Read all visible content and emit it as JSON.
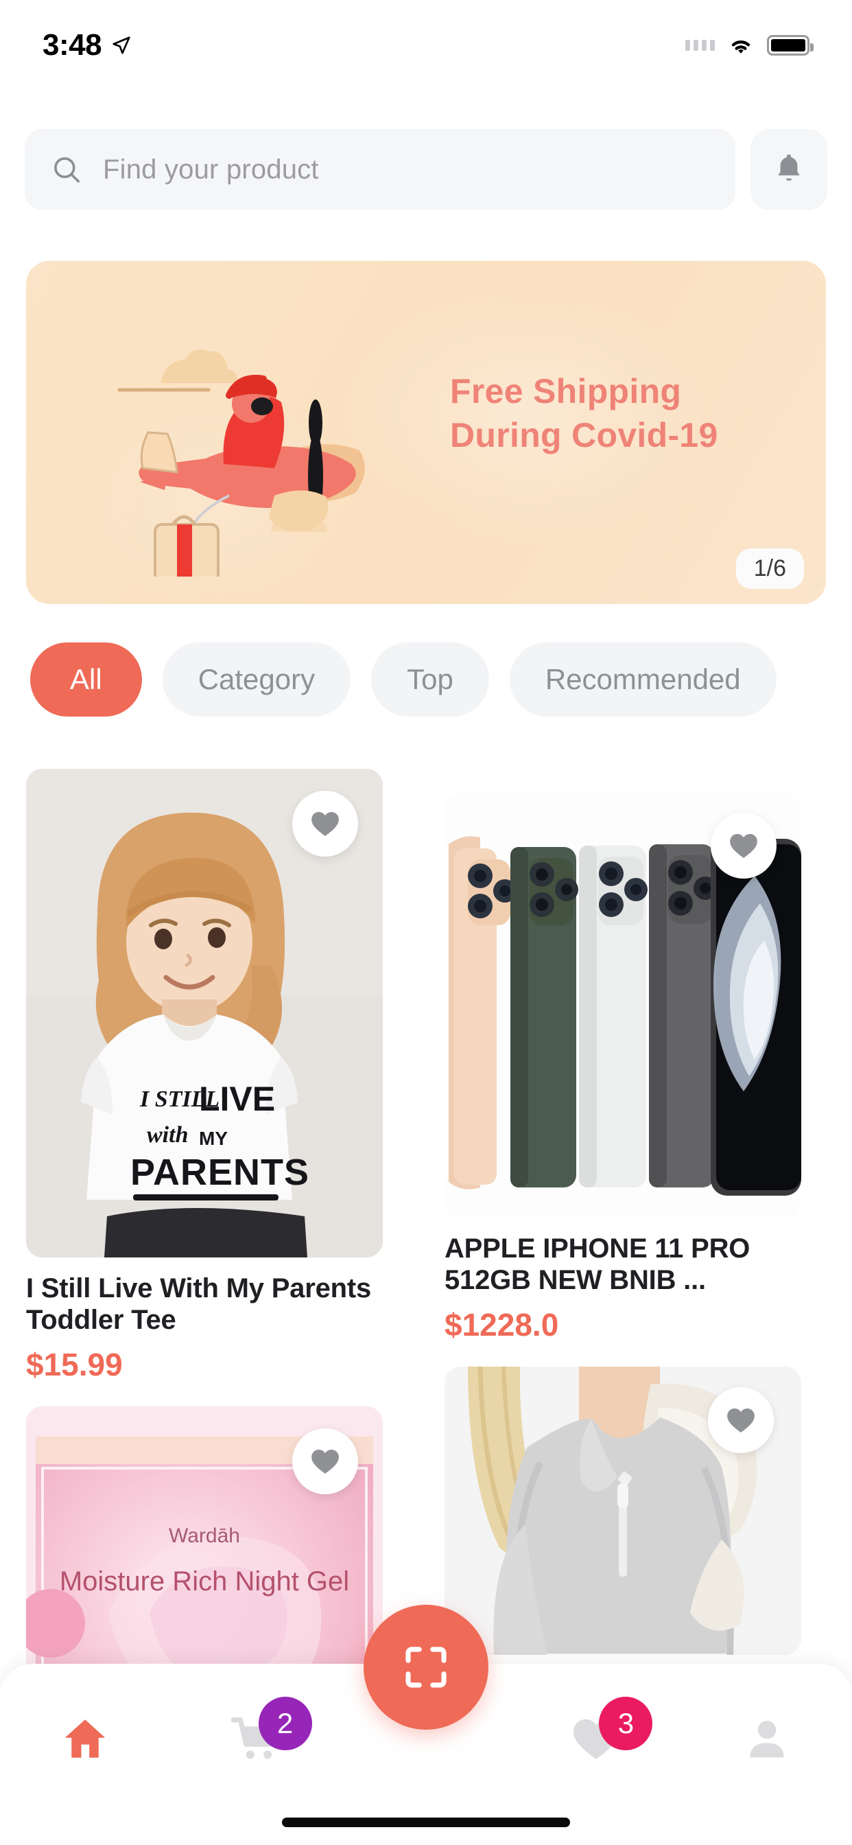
{
  "status_bar": {
    "time": "3:48",
    "location_icon": "location-arrow-icon",
    "signal_icon": "signal-dots-icon",
    "wifi_icon": "wifi-icon",
    "battery_icon": "battery-full-icon"
  },
  "search": {
    "placeholder": "Find your product",
    "value": "",
    "search_icon": "search-icon",
    "notification_icon": "bell-icon"
  },
  "banner": {
    "line1": "Free Shipping",
    "line2": "During Covid-19",
    "counter": "1/6",
    "bg_color": "#fbe4c7",
    "text_color": "#ef8377",
    "illustration": "airplane-delivery-illustration"
  },
  "filters": {
    "chips": [
      {
        "label": "All",
        "active": true
      },
      {
        "label": "Category",
        "active": false
      },
      {
        "label": "Top",
        "active": false
      },
      {
        "label": "Recommended",
        "active": false
      }
    ],
    "active_color": "#ef6a57",
    "inactive_color": "#f3f4f6"
  },
  "products": {
    "left": [
      {
        "title": "I Still Live With My Parents Toddler Tee",
        "price": "$15.99",
        "image": "toddler-girl-in-white-graphic-tee",
        "shirt_text_1": "I STILL",
        "shirt_text_2": "LIVE",
        "shirt_text_3": "with MY",
        "shirt_text_4": "PARENTS",
        "favorited": false
      },
      {
        "title": "",
        "price": "",
        "image": "wardah-moisture-rich-night-gel-box",
        "brand_text": "Wardāh",
        "product_text": "Moisture Rich Night Gel",
        "favorited": false
      }
    ],
    "right": [
      {
        "title": "APPLE IPHONE 11 PRO 512GB NEW BNIB ...",
        "price": "$1228.0",
        "image": "iphone-11-pro-color-lineup",
        "favorited": false
      },
      {
        "title": "",
        "price": "",
        "image": "woman-in-gray-sherpa-quarter-zip-pullover",
        "favorited": false
      }
    ],
    "price_color": "#ef6a57",
    "favorite_icon": "heart-icon"
  },
  "bottom_nav": {
    "items": [
      {
        "name": "home",
        "icon": "home-icon",
        "active": true,
        "badge": ""
      },
      {
        "name": "cart",
        "icon": "shopping-cart-icon",
        "active": false,
        "badge": "2",
        "badge_color": "#9726b8"
      },
      {
        "name": "favorites",
        "icon": "heart-icon",
        "active": false,
        "badge": "3",
        "badge_color": "#ea1b60"
      },
      {
        "name": "profile",
        "icon": "person-icon",
        "active": false,
        "badge": ""
      }
    ],
    "fab": {
      "icon": "scan-qr-icon",
      "color": "#ef6a57"
    },
    "active_color": "#ef6a57",
    "inactive_color": "#d8d8da"
  }
}
